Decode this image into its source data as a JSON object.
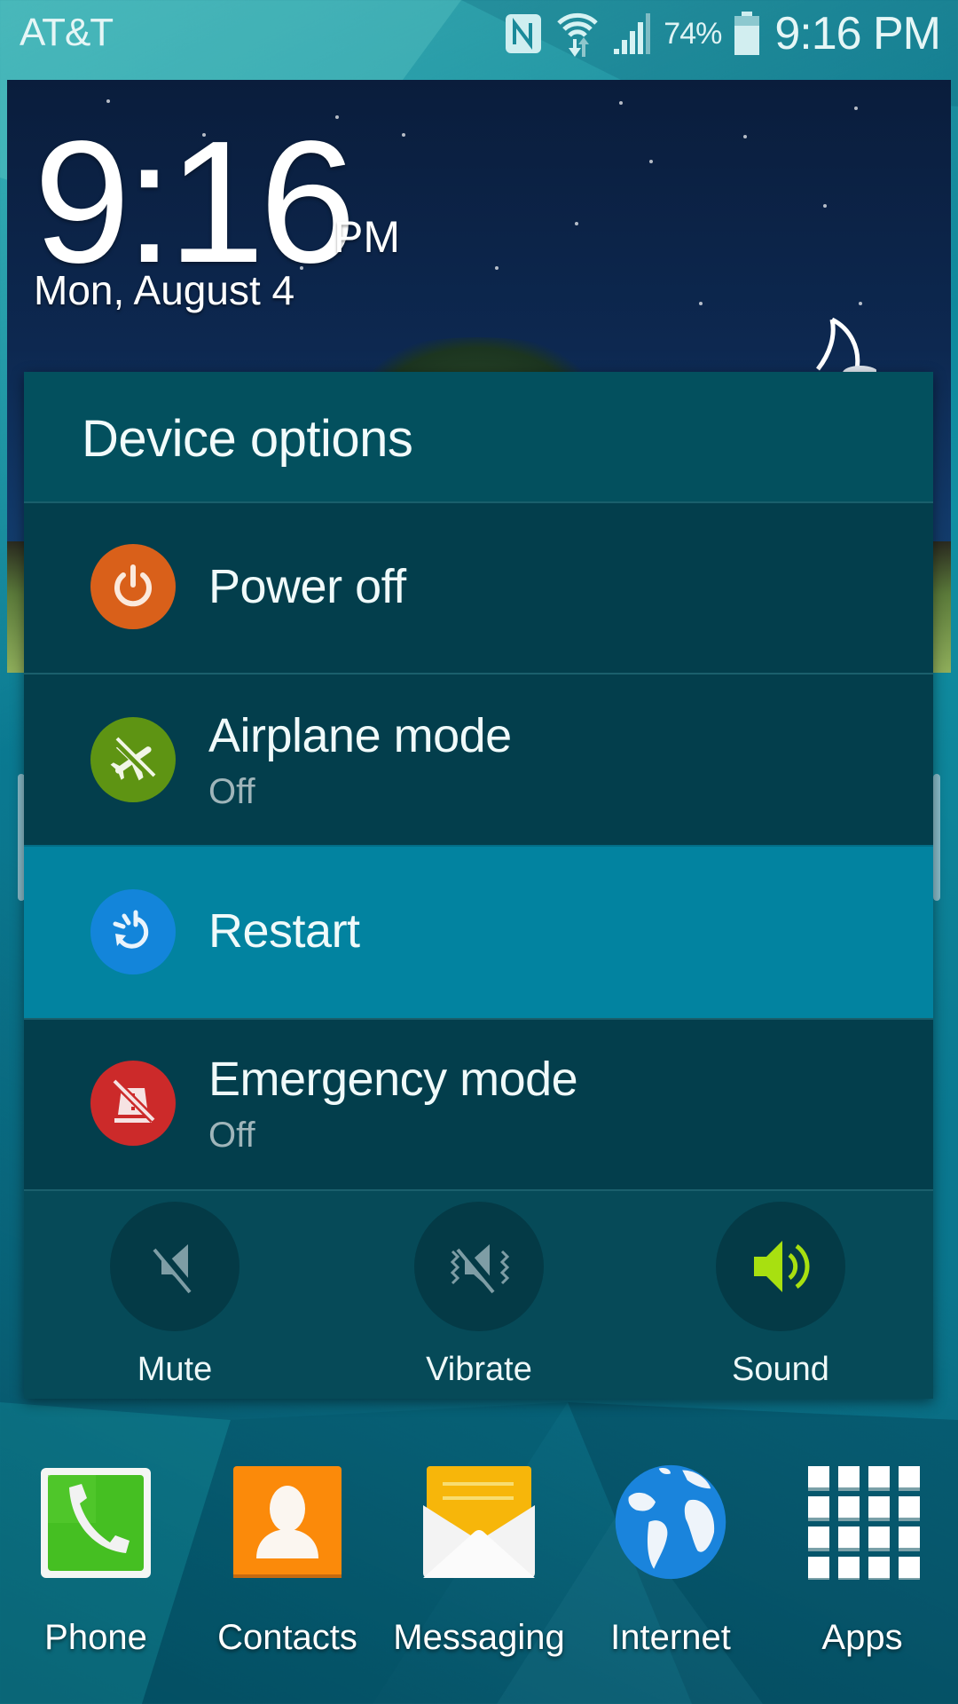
{
  "status_bar": {
    "carrier": "AT&T",
    "icons": [
      "nfc-icon",
      "wifi-icon",
      "signal-icon",
      "battery-icon"
    ],
    "battery_percent": "74%",
    "battery_level": 0.74,
    "time": "9:16 PM"
  },
  "clock_widget": {
    "time": "9:16",
    "ampm": "PM",
    "date": "Mon, August 4",
    "weather_icon": "moon-icon"
  },
  "dialog": {
    "title": "Device options",
    "options": [
      {
        "id": "power-off",
        "label": "Power off",
        "sublabel": null,
        "icon": "power-icon",
        "color": "#D9601A"
      },
      {
        "id": "airplane-mode",
        "label": "Airplane mode",
        "sublabel": "Off",
        "icon": "airplane-off-icon",
        "color": "#5E9413"
      },
      {
        "id": "restart",
        "label": "Restart",
        "sublabel": null,
        "icon": "restart-icon",
        "color": "#1385DA",
        "highlighted": true
      },
      {
        "id": "emergency-mode",
        "label": "Emergency mode",
        "sublabel": "Off",
        "icon": "emergency-off-icon",
        "color": "#CC2A2A"
      }
    ],
    "sound_modes": [
      {
        "id": "mute",
        "label": "Mute",
        "icon": "mute-icon",
        "active": false
      },
      {
        "id": "vibrate",
        "label": "Vibrate",
        "icon": "vibrate-icon",
        "active": false
      },
      {
        "id": "sound",
        "label": "Sound",
        "icon": "sound-icon",
        "active": true
      }
    ],
    "colors": {
      "header_bg": "#03505E",
      "row_bg": "#033E4C",
      "highlight_bg": "#0283A0",
      "sound_active": "#A8E010",
      "sound_inactive": "#7E9DA5"
    }
  },
  "dock": {
    "apps": [
      {
        "label": "Phone",
        "icon": "phone-icon"
      },
      {
        "label": "Contacts",
        "icon": "contacts-icon"
      },
      {
        "label": "Messaging",
        "icon": "messaging-icon"
      },
      {
        "label": "Internet",
        "icon": "internet-globe-icon"
      },
      {
        "label": "Apps",
        "icon": "apps-grid-icon"
      }
    ]
  }
}
